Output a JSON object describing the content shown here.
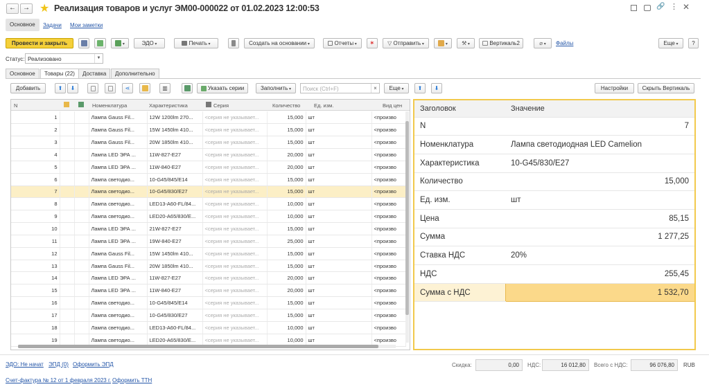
{
  "window": {
    "title": "Реализация товаров и услуг ЭМ00-000022 от 01.02.2023 12:00:53"
  },
  "top_tabs": [
    "Основное",
    "Задачи",
    "Мои заметки"
  ],
  "toolbar": {
    "post_close": "Провести и закрыть",
    "edo": "ЭДО",
    "print": "Печать",
    "create_based": "Создать на основании",
    "reports": "Отчеты",
    "send": "Отправить",
    "vertical2": "Вертикаль2",
    "files": "Файлы",
    "more": "Еще",
    "help": "?"
  },
  "status": {
    "label": "Статус:",
    "value": "Реализовано"
  },
  "tabs": [
    "Основное",
    "Товары (22)",
    "Доставка",
    "Дополнительно"
  ],
  "grid_toolbar": {
    "add": "Добавить",
    "series": "Указать серии",
    "fill": "Заполнить",
    "search_placeholder": "Поиск (Ctrl+F)",
    "more": "Еще",
    "settings": "Настройки",
    "hide_vertical": "Скрыть Вертикаль"
  },
  "columns": [
    "N",
    "Номенклатура",
    "Характеристика",
    "Серия",
    "Количество",
    "Ед. изм.",
    "Вид цен"
  ],
  "rows": [
    {
      "n": "1",
      "name": "Лампа Gauss Fil...",
      "char": "12W 1200lm 270...",
      "series": "<серия не указывает...",
      "qty": "15,000",
      "unit": "шт",
      "price": "<произво"
    },
    {
      "n": "2",
      "name": "Лампа Gauss Fil...",
      "char": "15W 1450lm 410...",
      "series": "<серия не указывает...",
      "qty": "15,000",
      "unit": "шт",
      "price": "<произво"
    },
    {
      "n": "3",
      "name": "Лампа Gauss Fil...",
      "char": "20W 1850lm 410...",
      "series": "<серия не указывает...",
      "qty": "15,000",
      "unit": "шт",
      "price": "<произво"
    },
    {
      "n": "4",
      "name": "Лампа LED ЭРА ...",
      "char": "11W-827-E27",
      "series": "<серия не указывает...",
      "qty": "20,000",
      "unit": "шт",
      "price": "<произво"
    },
    {
      "n": "5",
      "name": "Лампа LED ЭРА ...",
      "char": "11W-840-E27",
      "series": "<серия не указывает...",
      "qty": "20,000",
      "unit": "шт",
      "price": "<произво"
    },
    {
      "n": "6",
      "name": "Лампа светодио...",
      "char": "10-G45/845/E14",
      "series": "<серия не указывает...",
      "qty": "15,000",
      "unit": "шт",
      "price": "<произво"
    },
    {
      "n": "7",
      "name": "Лампа светодио...",
      "char": "10-G45/830/E27",
      "series": "<серия не указывает...",
      "qty": "15,000",
      "unit": "шт",
      "price": "<произво"
    },
    {
      "n": "8",
      "name": "Лампа светодио...",
      "char": "LED13-A60-FL/84...",
      "series": "<серия не указывает...",
      "qty": "10,000",
      "unit": "шт",
      "price": "<произво"
    },
    {
      "n": "9",
      "name": "Лампа светодио...",
      "char": "LED20-A65/830/E...",
      "series": "<серия не указывает...",
      "qty": "10,000",
      "unit": "шт",
      "price": "<произво"
    },
    {
      "n": "10",
      "name": "Лампа LED ЭРА ...",
      "char": "21W-827-E27",
      "series": "<серия не указывает...",
      "qty": "15,000",
      "unit": "шт",
      "price": "<произво"
    },
    {
      "n": "11",
      "name": "Лампа LED ЭРА ...",
      "char": "19W-840-E27",
      "series": "<серия не указывает...",
      "qty": "25,000",
      "unit": "шт",
      "price": "<произво"
    },
    {
      "n": "12",
      "name": "Лампа Gauss Fil...",
      "char": "15W 1450lm 410...",
      "series": "<серия не указывает...",
      "qty": "15,000",
      "unit": "шт",
      "price": "<произво"
    },
    {
      "n": "13",
      "name": "Лампа Gauss Fil...",
      "char": "20W 1850lm 410...",
      "series": "<серия не указывает...",
      "qty": "15,000",
      "unit": "шт",
      "price": "<произво"
    },
    {
      "n": "14",
      "name": "Лампа LED ЭРА ...",
      "char": "11W-827-E27",
      "series": "<серия не указывает...",
      "qty": "20,000",
      "unit": "шт",
      "price": "<произво"
    },
    {
      "n": "15",
      "name": "Лампа LED ЭРА ...",
      "char": "11W-840-E27",
      "series": "<серия не указывает...",
      "qty": "20,000",
      "unit": "шт",
      "price": "<произво"
    },
    {
      "n": "16",
      "name": "Лампа светодио...",
      "char": "10-G45/845/E14",
      "series": "<серия не указывает...",
      "qty": "15,000",
      "unit": "шт",
      "price": "<произво"
    },
    {
      "n": "17",
      "name": "Лампа светодио...",
      "char": "10-G45/830/E27",
      "series": "<серия не указывает...",
      "qty": "15,000",
      "unit": "шт",
      "price": "<произво"
    },
    {
      "n": "18",
      "name": "Лампа светодио...",
      "char": "LED13-A60-FL/84...",
      "series": "<серия не указывает...",
      "qty": "10,000",
      "unit": "шт",
      "price": "<произво"
    },
    {
      "n": "19",
      "name": "Лампа светодио...",
      "char": "LED20-A65/830/E...",
      "series": "<серия не указывает...",
      "qty": "10,000",
      "unit": "шт",
      "price": "<произво"
    }
  ],
  "selected_row": 7,
  "props_header": {
    "key": "Заголовок",
    "value": "Значение"
  },
  "props": [
    {
      "k": "N",
      "v": "7",
      "align": "right"
    },
    {
      "k": "Номенклатура",
      "v": "Лампа светодиодная LED Camelion",
      "align": "left"
    },
    {
      "k": "Характеристика",
      "v": "10-G45/830/E27",
      "align": "left"
    },
    {
      "k": "Количество",
      "v": "15,000",
      "align": "right"
    },
    {
      "k": "Ед. изм.",
      "v": "шт",
      "align": "left"
    },
    {
      "k": "Цена",
      "v": "85,15",
      "align": "right"
    },
    {
      "k": "Сумма",
      "v": "1 277,25",
      "align": "right"
    },
    {
      "k": "Ставка НДС",
      "v": "20%",
      "align": "left"
    },
    {
      "k": "НДС",
      "v": "255,45",
      "align": "right"
    },
    {
      "k": "Сумма с НДС",
      "v": "1 532,70",
      "align": "right"
    }
  ],
  "footer": {
    "edo_status": "ЭДО: Не начат",
    "epd": "ЭПД (0)",
    "make_epd": "Оформить ЭПД",
    "invoice": "Счет-фактура № 12 от 1 февраля 2023 г.",
    "make_ttn": "Оформить ТТН",
    "discount_label": "Скидка:",
    "discount": "0,00",
    "vat_label": "НДС:",
    "vat": "16 012,80",
    "total_label": "Всего с НДС:",
    "total": "96 076,80",
    "currency": "RUB"
  },
  "colors": {
    "accent": "#f5d03a",
    "selection": "#fcefc6",
    "link": "#2456a8"
  }
}
